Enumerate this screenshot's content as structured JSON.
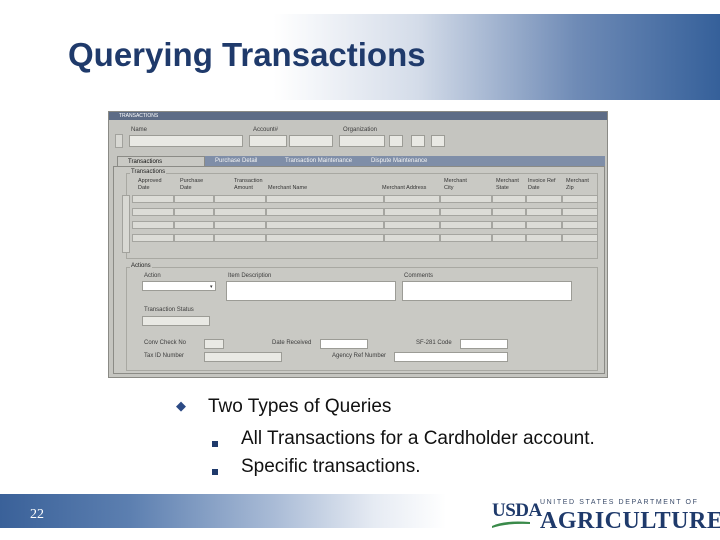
{
  "slide": {
    "title": "Querying Transactions",
    "page_number": "22"
  },
  "app": {
    "window_title": "TRANSACTIONS",
    "header_fields": {
      "name_label": "Name",
      "account_label": "Account#",
      "organization_label": "Organization"
    },
    "tabs": [
      {
        "label": "Transactions",
        "active": true
      },
      {
        "label": "Purchase Detail",
        "active": false
      },
      {
        "label": "Transaction Maintenance",
        "active": false
      },
      {
        "label": "Dispute Maintenance",
        "active": false
      }
    ],
    "transactions_group": {
      "label": "Transactions",
      "columns": [
        {
          "line1": "Approved",
          "line2": "Date"
        },
        {
          "line1": "Purchase",
          "line2": "Date"
        },
        {
          "line1": "Transaction",
          "line2": "Amount"
        },
        {
          "line1": "",
          "line2": "Merchant Name"
        },
        {
          "line1": "",
          "line2": "Merchant Address"
        },
        {
          "line1": "Merchant",
          "line2": "City"
        },
        {
          "line1": "Merchant",
          "line2": "State"
        },
        {
          "line1": "Invoice Ref",
          "line2": "Date"
        },
        {
          "line1": "Merchant",
          "line2": "Zip"
        }
      ]
    },
    "actions_group": {
      "label": "Actions",
      "action_label": "Action",
      "item_description_label": "Item Description",
      "comments_label": "Comments",
      "transaction_status_label": "Transaction Status",
      "conv_check_no_label": "Conv Check No",
      "date_received_label": "Date Received",
      "sf_code_label": "SF-281 Code",
      "tax_id_label": "Tax ID Number",
      "agency_ref_label": "Agency Ref Number"
    }
  },
  "bullets": {
    "main": "Two Types of Queries",
    "subs": [
      "All Transactions for a Cardholder account.",
      "Specific transactions."
    ]
  },
  "logo": {
    "mark": "USDA",
    "department": "UNITED STATES DEPARTMENT OF",
    "agriculture": "AGRICULTURE"
  },
  "colors": {
    "title": "#1f3a6b",
    "accent": "#35609a",
    "tab_inactive": "#7f8ea8"
  }
}
